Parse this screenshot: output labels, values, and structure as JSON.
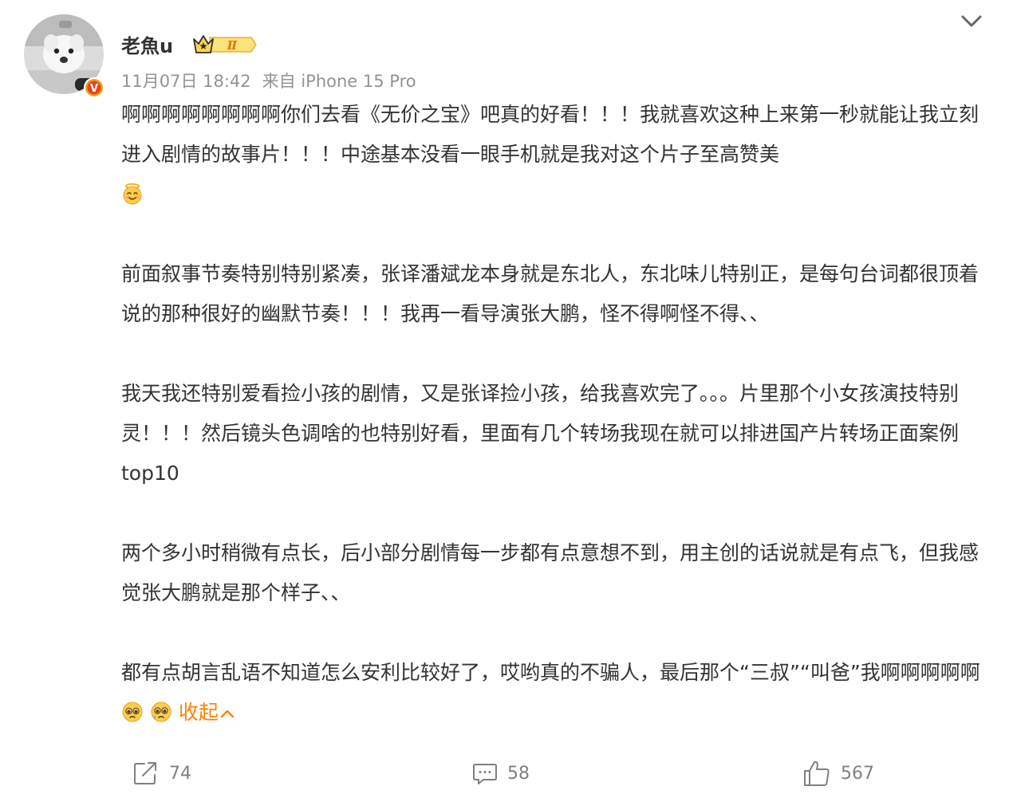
{
  "author": {
    "name": "老魚u",
    "level_badge": "Ⅱ",
    "avatar_icon": "puppy-avatar-icon",
    "verified_badge": "V"
  },
  "meta": {
    "time": "11月07日 18:42",
    "source": "来自 iPhone 15 Pro"
  },
  "post": {
    "p1": "啊啊啊啊啊啊啊啊你们去看《无价之宝》吧真的好看！！！我就喜欢这种上来第一秒就能让我立刻进入剧情的故事片！！！中途基本没看一眼手机就是我对这个片子至高赞美",
    "p2": "前面叙事节奏特别特别紧凑，张译潘斌龙本身就是东北人，东北味儿特别正，是每句台词都很顶着说的那种很好的幽默节奏！！！我再一看导演张大鹏，怪不得啊怪不得、、",
    "p3": "我天我还特别爱看捡小孩的剧情，又是张译捡小孩，给我喜欢完了。。。片里那个小女孩演技特别灵！！！然后镜头色调啥的也特别好看，里面有几个转场我现在就可以排进国产片转场正面案例top10",
    "p4": "两个多小时稍微有点长，后小部分剧情每一步都有点意想不到，用主创的话说就是有点飞，但我感觉张大鹏就是那个样子、、",
    "p5": "都有点胡言乱语不知道怎么安利比较好了，哎哟真的不骗人，最后那个“三叔”“叫爸”我啊啊啊啊啊",
    "collapse_label": "收起"
  },
  "actions": {
    "repost_count": "74",
    "comment_count": "58",
    "like_count": "567"
  },
  "colors": {
    "accent": "#ff8200",
    "text": "#333333",
    "meta": "#939393",
    "icon": "#808080"
  }
}
